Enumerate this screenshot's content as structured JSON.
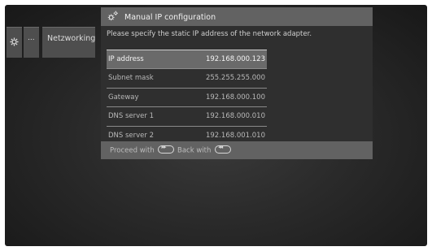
{
  "menu": {
    "more_label": "...",
    "network_label": "Netzworking"
  },
  "dialog": {
    "title": "Manual IP configuration",
    "instruction": "Please specify the static IP address of the network adapter.",
    "fields": [
      {
        "label": "IP address",
        "value": "192.168.000.123",
        "selected": true
      },
      {
        "label": "Subnet mask",
        "value": "255.255.255.000",
        "selected": false
      },
      {
        "label": "Gateway",
        "value": "192.168.000.100",
        "selected": false
      },
      {
        "label": "DNS server 1",
        "value": "192.168.000.010",
        "selected": false
      },
      {
        "label": "DNS server 2",
        "value": "192.168.001.010",
        "selected": false
      }
    ],
    "footer": {
      "proceed_label": "Proceed with",
      "proceed_key_icon": "forward-key-icon",
      "back_label": "Back with",
      "back_key_icon": "rewind-key-icon"
    }
  },
  "colors": {
    "dialog_frame": "#626262",
    "dialog_body": "#2f2f2f",
    "selected_row": "#6a6a6a"
  }
}
